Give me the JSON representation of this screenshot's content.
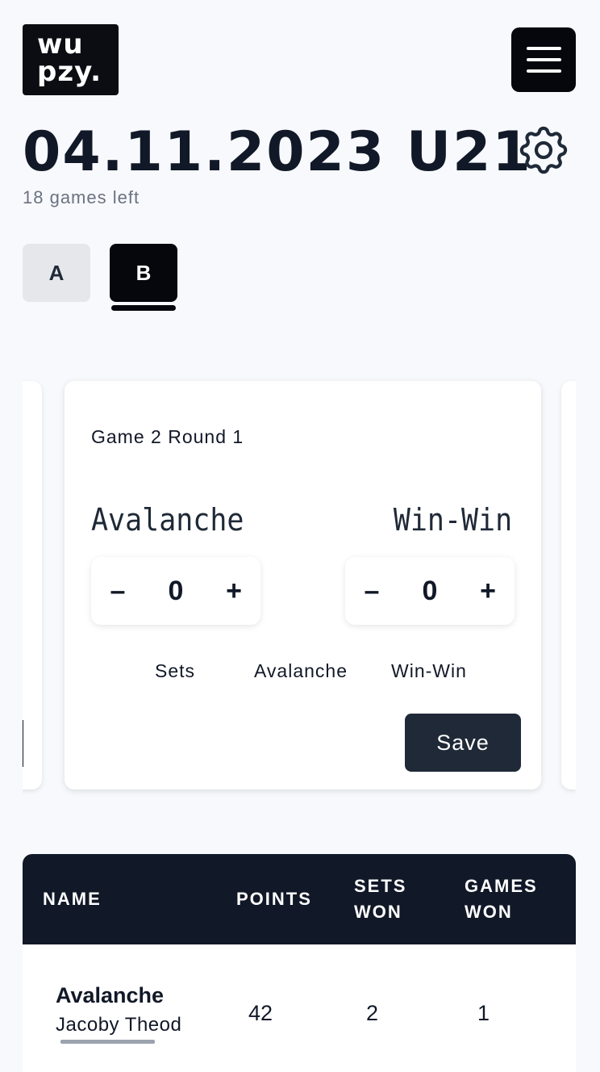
{
  "header": {
    "logo_line1": "wu",
    "logo_line2": "pzy.",
    "menu_icon": "hamburger-menu-icon",
    "settings_icon": "gear-icon"
  },
  "page": {
    "title": "04.11.2023 U21",
    "subtitle": "18 games left"
  },
  "tabs": [
    {
      "label": "A",
      "active": false
    },
    {
      "label": "B",
      "active": true
    }
  ],
  "game_card": {
    "label": "Game 2 Round 1",
    "team_left": "Avalanche",
    "team_right": "Win-Win",
    "stepper_left": {
      "minus": "–",
      "value": "0",
      "plus": "+"
    },
    "stepper_right": {
      "minus": "–",
      "value": "0",
      "plus": "+"
    },
    "label_sets": "Sets",
    "label_team_left": "Avalanche",
    "label_team_right": "Win-Win",
    "save_label": "Save"
  },
  "standings": {
    "columns": {
      "name": "NAME",
      "points": "POINTS",
      "sets_won_1": "SETS",
      "sets_won_2": "WON",
      "games_won_1": "GAMES",
      "games_won_2": "WON"
    },
    "rows": [
      {
        "team": "Avalanche",
        "player": "Jacoby Theod",
        "points": "42",
        "sets_won": "2",
        "games_won": "1"
      }
    ]
  },
  "colors": {
    "background": "#f7f9fc",
    "dark": "#05070d",
    "table_header": "#111827",
    "save_button": "#1f2937",
    "inactive_tab": "#e5e7eb"
  }
}
